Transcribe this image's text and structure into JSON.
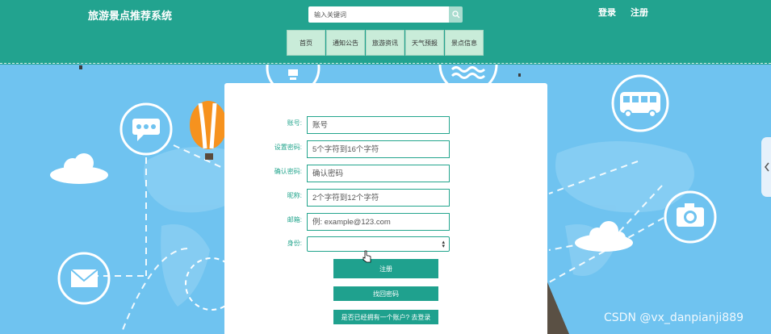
{
  "header": {
    "site_title": "旅游景点推荐系统",
    "search_placeholder": "输入关键词",
    "login_link": "登录",
    "register_link": "注册",
    "nav": [
      "首页",
      "通知公告",
      "旅游资讯",
      "天气预报",
      "景点信息"
    ]
  },
  "form": {
    "fields": [
      {
        "label": "账号:",
        "placeholder": "账号"
      },
      {
        "label": "设置密码:",
        "placeholder": "5个字符到16个字符"
      },
      {
        "label": "确认密码:",
        "placeholder": "确认密码"
      },
      {
        "label": "昵称:",
        "placeholder": "2个字符到12个字符"
      },
      {
        "label": "邮箱:",
        "placeholder": "例: example@123.com"
      }
    ],
    "identity_label": "身份:",
    "identity_value": "",
    "register_button": "注册",
    "forgot_button": "找回密码",
    "login_button": "是否已经拥有一个账户? 去登录"
  },
  "icons": [
    "search-icon",
    "bulb-icon",
    "waves-icon",
    "chat-icon",
    "bus-icon",
    "camera-icon",
    "mail-icon",
    "hot-air-balloon-icon",
    "cloud-icon",
    "chevron-left-icon",
    "caret-updown-icon",
    "pointer-cursor-icon"
  ],
  "colors": {
    "header_bg": "#22a38f",
    "sky_bg": "#6fc3f0",
    "accent": "#1fa18e",
    "nav_bg": "#c9ecd9"
  },
  "watermark": "CSDN @vx_danpianji889"
}
